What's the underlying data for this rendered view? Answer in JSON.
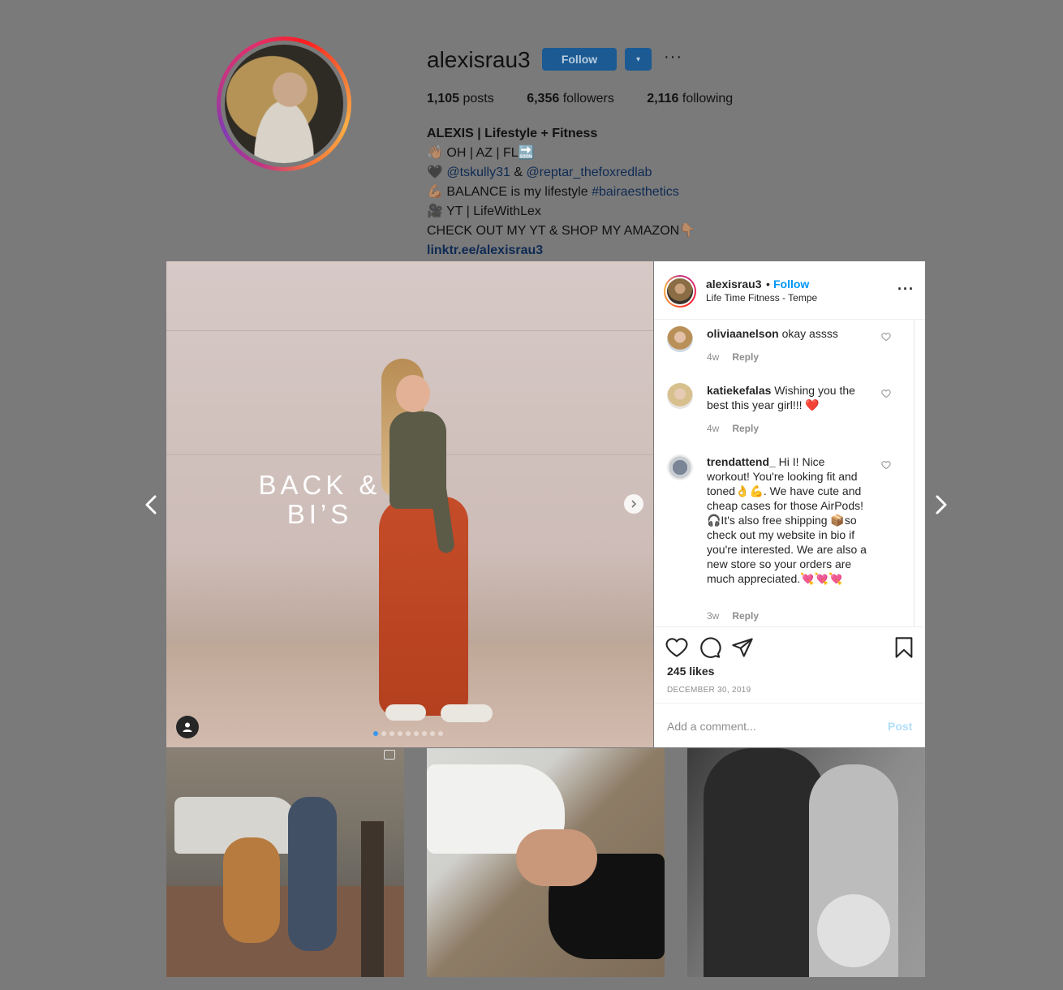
{
  "profile": {
    "username": "alexisrau3",
    "follow_label": "Follow",
    "dropdown_label": "▾",
    "more_label": "···",
    "stats": [
      {
        "value": "1,105",
        "label": "posts"
      },
      {
        "value": "6,356",
        "label": "followers"
      },
      {
        "value": "2,116",
        "label": "following"
      }
    ],
    "bio": {
      "name": "ALEXIS | Lifestyle + Fitness",
      "line1": "👋🏽 OH | AZ | FL🔜",
      "line2_prefix": "🖤 ",
      "mention1": "@tskully31",
      "line2_mid": " & ",
      "mention2": "@reptar_thefoxredlab",
      "line3_prefix": "💪🏽 BALANCE is my lifestyle ",
      "hashtag": "#bairaesthetics",
      "line4": "🎥 YT | LifeWithLex",
      "line5": "CHECK OUT MY YT & SHOP MY AMAZON👇🏽",
      "link": "linktr.ee/alexisrau3"
    }
  },
  "post": {
    "overlay_text_line1": "BACK &",
    "overlay_text_line2": "BI’S",
    "carousel_count": 9,
    "carousel_active_index": 0,
    "header": {
      "username": "alexisrau3",
      "bullet": "•",
      "follow_label": "Follow",
      "location": "Life Time Fitness - Tempe",
      "more_label": "···"
    },
    "comments": [
      {
        "username": "oliviaanelson",
        "text": " okay assss",
        "age": "4w",
        "reply_label": "Reply"
      },
      {
        "username": "katiekefalas",
        "text": " Wishing you the best this year girl!!! ❤️",
        "age": "4w",
        "reply_label": "Reply"
      },
      {
        "username": "trendattend_",
        "text": " Hi I! Nice workout! You're looking fit and toned👌💪. We have cute and cheap cases for those AirPods! 🎧It's also free shipping 📦so check out my website in bio if you're interested. We are also a new store so your orders are much appreciated.💘💘💘",
        "age": "3w",
        "reply_label": "Reply"
      }
    ],
    "likes": "245 likes",
    "date": "DECEMBER 30, 2019",
    "comment_placeholder": "Add a comment...",
    "post_label": "Post"
  },
  "colors": {
    "overlay_bg": "#7a7a7a",
    "accent_blue": "#0095f6",
    "dim_blue_button": "#1b5a93"
  }
}
